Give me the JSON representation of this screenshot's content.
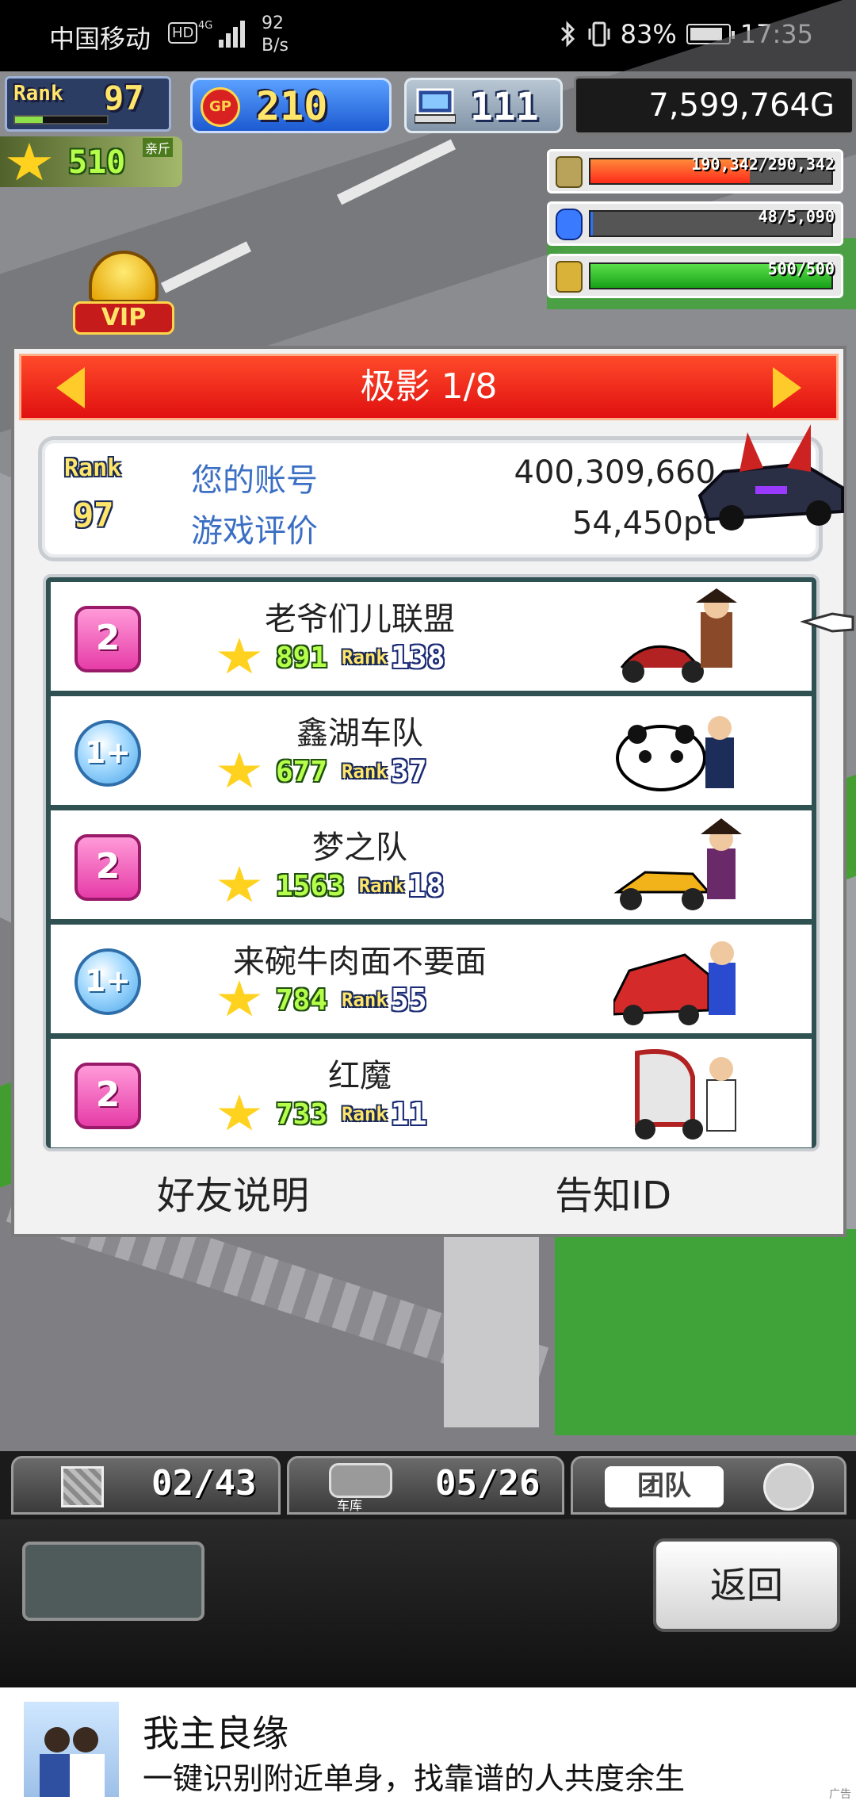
{
  "status_bar": {
    "carrier": "中国移动",
    "hd": "HD",
    "net": "4G",
    "speed_value": "92",
    "speed_unit": "B/s",
    "battery": "83%",
    "time": "17:35"
  },
  "hud": {
    "rank_label": "Rank",
    "rank_value": "97",
    "gp_badge": "GP",
    "gp_value": "210",
    "pc_value": "111",
    "money": "7,599,764G",
    "star_value": "510",
    "star_tag": "亲斤",
    "vip": "VIP"
  },
  "resources": [
    {
      "icon": "coin-stack-icon",
      "value": "190,342/290,342",
      "fill_fraction": 0.66,
      "color": "#ff4422"
    },
    {
      "icon": "fuel-bottle-icon",
      "value": "48/5,090",
      "fill_fraction": 0.01,
      "color": "#2a72ff"
    },
    {
      "icon": "wheat-icon",
      "value": "500/500",
      "fill_fraction": 1.0,
      "color": "#22bb22"
    }
  ],
  "dialog": {
    "title": "极影 1/8",
    "rank_label": "Rank",
    "rank_value": "97",
    "account_label": "您的账号",
    "account_value": "400,309,660",
    "score_label": "游戏评价",
    "score_value": "54,450pt",
    "friends": [
      {
        "badge": "2",
        "badge_style": "pink",
        "name": "老爷们儿联盟",
        "stars": "891",
        "rank_word": "Rank",
        "rank": "138"
      },
      {
        "badge": "1+",
        "badge_style": "blue",
        "name": "鑫湖车队",
        "stars": "677",
        "rank_word": "Rank",
        "rank": "37"
      },
      {
        "badge": "2",
        "badge_style": "pink",
        "name": "梦之队",
        "stars": "1563",
        "rank_word": "Rank",
        "rank": "18"
      },
      {
        "badge": "1+",
        "badge_style": "blue",
        "name": "来碗牛肉面不要面",
        "stars": "784",
        "rank_word": "Rank",
        "rank": "55"
      },
      {
        "badge": "2",
        "badge_style": "pink",
        "name": "红魔",
        "stars": "733",
        "rank_word": "Rank",
        "rank": "11"
      }
    ],
    "friend_help": "好友说明",
    "notify_id": "告知ID"
  },
  "bottom_tabs": {
    "boxes": "02/43",
    "garage_label": "车库",
    "garage": "05/26",
    "team_label": "团队"
  },
  "panel": {
    "back": "返回"
  },
  "ad": {
    "title": "我主良缘",
    "text": "一键识别附近单身，找靠谱的人共度余生",
    "mark": "广告"
  },
  "colors": {
    "dialog_header": "#e01010",
    "accent_blue": "#3b6fc4",
    "list_frame": "#2f5152"
  }
}
